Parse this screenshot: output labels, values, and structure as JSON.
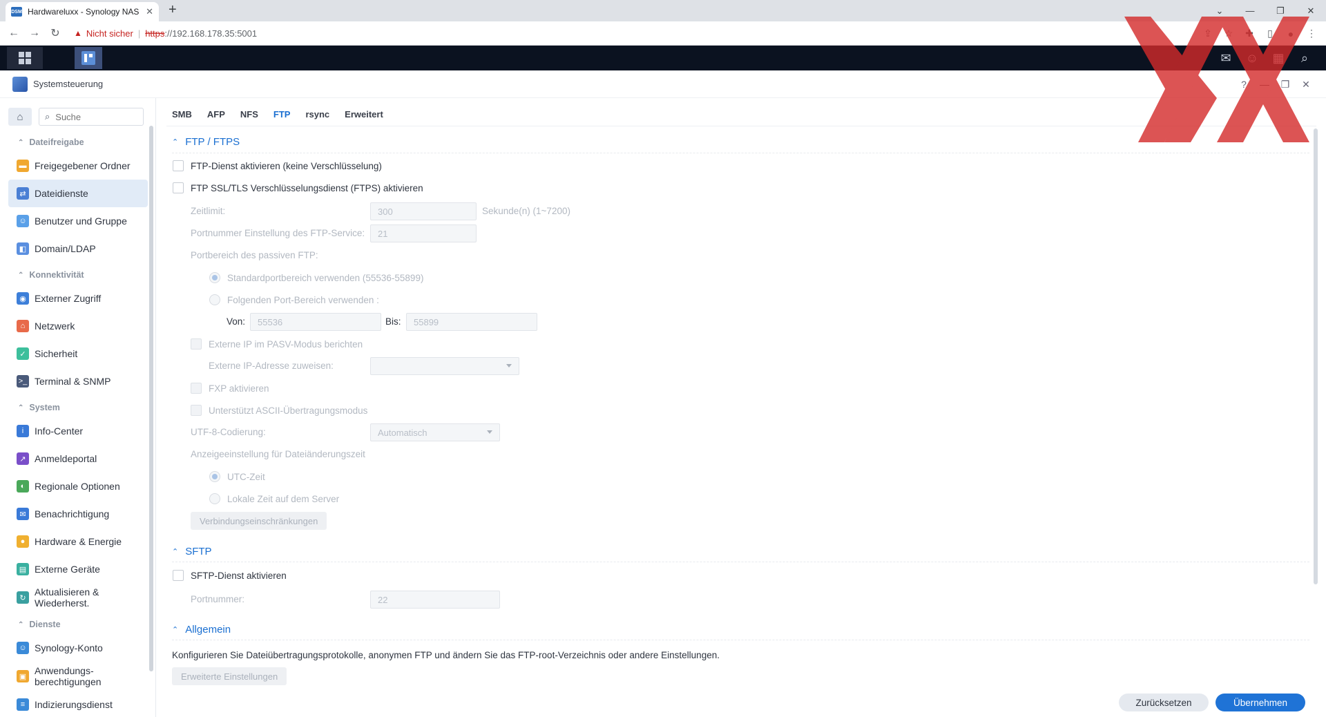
{
  "browser": {
    "tab_title": "Hardwareluxx - Synology NAS",
    "favicon_text": "DSM",
    "not_secure": "Nicht sicher",
    "url_scheme": "https",
    "url_rest": "://192.168.178.35:5001"
  },
  "window": {
    "title": "Systemsteuerung"
  },
  "sidebar": {
    "search_placeholder": "Suche",
    "sections": [
      {
        "label": "Dateifreigabe",
        "items": [
          {
            "label": "Freigegebener Ordner",
            "icon": "folder-icon",
            "color": "#f0a830"
          },
          {
            "label": "Dateidienste",
            "icon": "file-services-icon",
            "color": "#4a7fd4",
            "active": true
          },
          {
            "label": "Benutzer und Gruppe",
            "icon": "users-icon",
            "color": "#5aa0e8"
          },
          {
            "label": "Domain/LDAP",
            "icon": "domain-icon",
            "color": "#5a8fe0"
          }
        ]
      },
      {
        "label": "Konnektivität",
        "items": [
          {
            "label": "Externer Zugriff",
            "icon": "globe-icon",
            "color": "#3d7fd9"
          },
          {
            "label": "Netzwerk",
            "icon": "house-icon",
            "color": "#e86a4a"
          },
          {
            "label": "Sicherheit",
            "icon": "shield-icon",
            "color": "#3dbf9c"
          },
          {
            "label": "Terminal & SNMP",
            "icon": "terminal-icon",
            "color": "#4a5a7a"
          }
        ]
      },
      {
        "label": "System",
        "items": [
          {
            "label": "Info-Center",
            "icon": "info-icon",
            "color": "#3a7ad8"
          },
          {
            "label": "Anmeldeportal",
            "icon": "login-portal-icon",
            "color": "#7a4fc9"
          },
          {
            "label": "Regionale Optionen",
            "icon": "regional-icon",
            "color": "#4aa85a"
          },
          {
            "label": "Benachrichtigung",
            "icon": "notification-icon",
            "color": "#3a7ad8"
          },
          {
            "label": "Hardware & Energie",
            "icon": "bulb-icon",
            "color": "#f0b030"
          },
          {
            "label": "Externe Geräte",
            "icon": "external-device-icon",
            "color": "#3ab0a0"
          },
          {
            "label": "Aktualisieren & Wiederherst.",
            "icon": "update-icon",
            "color": "#3aa0a0"
          }
        ]
      },
      {
        "label": "Dienste",
        "items": [
          {
            "label": "Synology-Konto",
            "icon": "account-icon",
            "color": "#3a8ad8"
          },
          {
            "label": "Anwendungs-berechtigungen",
            "icon": "lock-icon",
            "color": "#f0a830"
          },
          {
            "label": "Indizierungsdienst",
            "icon": "index-icon",
            "color": "#3a8ad8"
          }
        ]
      }
    ]
  },
  "tabs": [
    "SMB",
    "AFP",
    "NFS",
    "FTP",
    "rsync",
    "Erweitert"
  ],
  "active_tab": "FTP",
  "ftp": {
    "heading": "FTP / FTPS",
    "enable_ftp": "FTP-Dienst aktivieren (keine Verschlüsselung)",
    "enable_ftps": "FTP SSL/TLS Verschlüsselungsdienst (FTPS) aktivieren",
    "timeout_label": "Zeitlimit:",
    "timeout_value": "300",
    "timeout_unit": "Sekunde(n) (1~7200)",
    "port_label": "Portnummer Einstellung des FTP-Service:",
    "port_value": "21",
    "passive_label": "Portbereich des passiven FTP:",
    "default_range": "Standardportbereich verwenden (55536-55899)",
    "custom_range": "Folgenden Port-Bereich verwenden :",
    "from_label": "Von:",
    "from_value": "55536",
    "to_label": "Bis:",
    "to_value": "55899",
    "report_ip": "Externe IP im PASV-Modus berichten",
    "assign_ip_label": "Externe IP-Adresse zuweisen:",
    "enable_fxp": "FXP aktivieren",
    "ascii_mode": "Unterstützt ASCII-Übertragungsmodus",
    "utf8_label": "UTF-8-Codierung:",
    "utf8_value": "Automatisch",
    "time_display_label": "Anzeigeeinstellung für Dateiänderungszeit",
    "utc_time": "UTC-Zeit",
    "local_time": "Lokale Zeit auf dem Server",
    "conn_limits_button": "Verbindungseinschränkungen"
  },
  "sftp": {
    "heading": "SFTP",
    "enable_sftp": "SFTP-Dienst aktivieren",
    "port_label": "Portnummer:",
    "port_value": "22"
  },
  "general": {
    "heading": "Allgemein",
    "description": "Konfigurieren Sie Dateiübertragungsprotokolle, anonymen FTP und ändern Sie das FTP-root-Verzeichnis oder andere Einstellungen.",
    "advanced_button": "Erweiterte Einstellungen"
  },
  "footer": {
    "reset": "Zurücksetzen",
    "apply": "Übernehmen"
  },
  "colors": {
    "accent": "#1a6fd1",
    "watermark": "#d42a2a"
  }
}
